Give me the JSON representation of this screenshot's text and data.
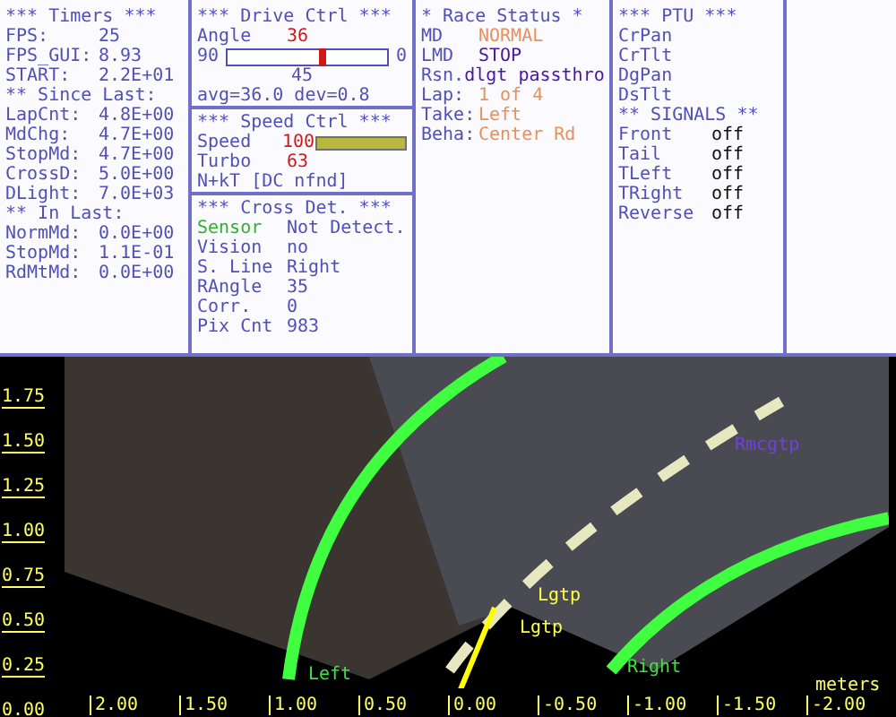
{
  "panels": [
    {
      "items": [
        {
          "kind": "heading",
          "text": "*** Timers ***"
        },
        {
          "kind": "pair",
          "label": "FPS:",
          "value": "25"
        },
        {
          "kind": "pair",
          "label": "FPS_GUI:",
          "value": "8.93"
        },
        {
          "kind": "pair",
          "label": "START:",
          "value": "2.2E+01"
        },
        {
          "kind": "heading",
          "text": "** Since Last:"
        },
        {
          "kind": "pair",
          "label": "LapCnt:",
          "value": "4.8E+00"
        },
        {
          "kind": "pair",
          "label": "MdChg:",
          "value": "4.7E+00"
        },
        {
          "kind": "pair",
          "label": "StopMd:",
          "value": "4.7E+00"
        },
        {
          "kind": "pair",
          "label": "CrossD:",
          "value": "5.0E+00"
        },
        {
          "kind": "pair",
          "label": "DLight:",
          "value": "7.0E+03"
        },
        {
          "kind": "heading",
          "text": "** In Last:"
        },
        {
          "kind": "pair",
          "label": "NormMd:",
          "value": "0.0E+00"
        },
        {
          "kind": "pair",
          "label": "StopMd:",
          "value": "1.1E-01"
        },
        {
          "kind": "pair",
          "label": "RdMtMd:",
          "value": "0.0E+00"
        }
      ]
    },
    {
      "items": [
        {
          "kind": "heading",
          "text": "***  Drive Ctrl  ***"
        },
        {
          "kind": "pair",
          "label": "Angle",
          "value": "36",
          "color": "#d01818"
        },
        {
          "kind": "gauge",
          "min": "90",
          "max": "0",
          "level": 0.6
        },
        {
          "kind": "center",
          "text": "45"
        },
        {
          "kind": "note",
          "text": "avg=36.0  dev=0.8"
        },
        {
          "kind": "heading",
          "text": "***  Speed Ctrl  ***"
        },
        {
          "kind": "bar",
          "label": "Speed",
          "value": "100",
          "color": "#d01818",
          "level": 1
        },
        {
          "kind": "pair",
          "label": "Turbo",
          "value": "63",
          "color": "#d01818"
        },
        {
          "kind": "note",
          "text": "N+kT [DC nfnd]"
        },
        {
          "kind": "heading",
          "text": "*** Cross Det. ***"
        },
        {
          "kind": "flag",
          "label": "Sensor",
          "value": "Not Detect.",
          "color": "#30b030"
        },
        {
          "kind": "pair",
          "label": "Vision",
          "value": "no"
        },
        {
          "kind": "pair",
          "label": "S. Line",
          "value": "Right"
        },
        {
          "kind": "pair",
          "label": "RAngle",
          "value": "35"
        },
        {
          "kind": "pair",
          "label": "Corr.",
          "value": "0"
        },
        {
          "kind": "pair",
          "label": "Pix Cnt",
          "value": "983"
        }
      ]
    },
    {
      "items": [
        {
          "kind": "heading",
          "text": "* Race Status *"
        },
        {
          "kind": "pair",
          "label": "MD",
          "value": "NORMAL",
          "color": "#e8905c"
        },
        {
          "kind": "pair",
          "label": "LMD",
          "value": "STOP",
          "color": "#4a14a8"
        },
        {
          "kind": "pair",
          "label": "Rsn.",
          "value": "dlgt passthro",
          "color": "#4a14a8"
        },
        {
          "kind": "pair",
          "label": "Lap:",
          "value": "1 of 4",
          "color": "#e8905c"
        },
        {
          "kind": "pair",
          "label": "Take:",
          "value": "Left",
          "color": "#e8905c"
        },
        {
          "kind": "pair",
          "label": "Beha:",
          "value": "Center Rd",
          "color": "#e8905c"
        }
      ]
    },
    {
      "items": [
        {
          "kind": "heading",
          "text": "*** PTU ***"
        },
        {
          "kind": "label",
          "text": "CrPan"
        },
        {
          "kind": "label",
          "text": "CrTlt"
        },
        {
          "kind": "label",
          "text": "DgPan"
        },
        {
          "kind": "label",
          "text": "DsTlt"
        },
        {
          "kind": "heading",
          "text": "** SIGNALS **"
        },
        {
          "kind": "pair",
          "label": "Front",
          "value": "off",
          "color": "#101010"
        },
        {
          "kind": "pair",
          "label": "Tail",
          "value": "off",
          "color": "#101010"
        },
        {
          "kind": "pair",
          "label": "TLeft",
          "value": "off",
          "color": "#101010"
        },
        {
          "kind": "pair",
          "label": "TRight",
          "value": "off",
          "color": "#101010"
        },
        {
          "kind": "pair",
          "label": "Reverse",
          "value": "off",
          "color": "#101010"
        }
      ]
    }
  ],
  "view": {
    "y_ticks": [
      "1.75",
      "1.50",
      "1.25",
      "1.00",
      "0.75",
      "0.50",
      "0.25",
      "0.00"
    ],
    "x_ticks": [
      "2.00",
      "1.50",
      "1.00",
      "0.50",
      "0.00",
      "-0.50",
      "-1.00",
      "-1.50",
      "-2.00"
    ],
    "unit": "meters",
    "markers": [
      {
        "text": "Left",
        "color": "#40e040"
      },
      {
        "text": "Right",
        "color": "#40e040"
      },
      {
        "text": "Lgtp",
        "color": "#ffff40"
      },
      {
        "text": "Lgtp",
        "color": "#ffff40"
      },
      {
        "text": "Rmcgtp",
        "color": "#7040e0"
      }
    ]
  }
}
